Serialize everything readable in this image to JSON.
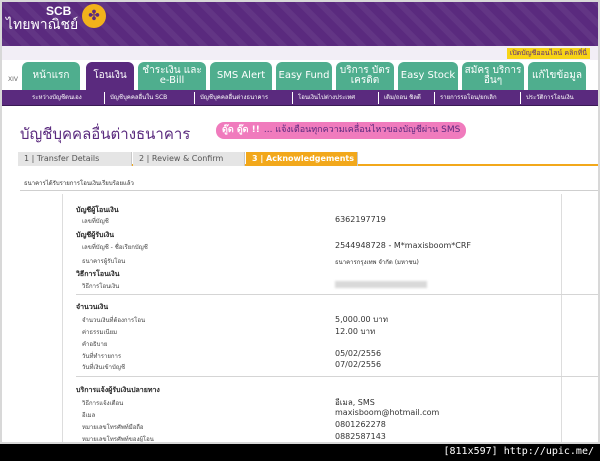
{
  "header": {
    "logo_text": "SCB",
    "logo_thai": "ไทยพาณิชย์",
    "logo_icon": "scb-emblem-icon",
    "badge": "เปิดบัญชีออนไลน์ คลิกที่นี่",
    "side_label": "XIV"
  },
  "tabs": [
    {
      "label": "หน้าแรก"
    },
    {
      "label": "โอนเงิน"
    },
    {
      "label": "ชำระเงิน และ e-Bill"
    },
    {
      "label": "SMS Alert"
    },
    {
      "label": "Easy Fund"
    },
    {
      "label": "บริการ บัตรเครดิต"
    },
    {
      "label": "Easy Stock"
    },
    {
      "label": "สมัคร บริการอื่นๆ"
    },
    {
      "label": "แก้ไขข้อมูล"
    }
  ],
  "subnav": [
    {
      "label": "ระหว่างบัญชีตนเอง"
    },
    {
      "label": "บัญชีบุคคลอื่นใน SCB"
    },
    {
      "label": "บัญชีบุคคลอื่นต่างธนาคาร"
    },
    {
      "label": "โอนเงินไปต่างประเทศ"
    },
    {
      "label": "เติม/ถอน ชิลดี"
    },
    {
      "label": "รายการรอโอน/ยกเลิก"
    },
    {
      "label": "ประวัติการโอนเงิน"
    }
  ],
  "page": {
    "title": "บัญชีบุคคลอื่นต่างธนาคาร",
    "promo_deal": "ดู๊ด ดู๊ด !!",
    "promo_text": "... แจ้งเตือนทุกความเคลื่อนไหวของบัญชีผ่าน SMS",
    "confirm": "ธนาคารได้รับรายการโอนเงินเรียบร้อยแล้ว"
  },
  "steps": [
    {
      "label": "1 | Transfer Details"
    },
    {
      "label": "2 | Review & Confirm"
    },
    {
      "label": "3 | Acknowledgements"
    }
  ],
  "details": {
    "from_head": "บัญชีผู้โอนเงิน",
    "from_account_label": "เลขที่บัญชี",
    "from_account": "6362197719",
    "to_head": "บัญชีผู้รับเงิน",
    "to_account_label": "เลขที่บัญชี - ชื่อเรียกบัญชี",
    "to_account": "2544948728 - M*maxisboom*CRF",
    "to_bank_label": "ธนาคารผู้รับโอน",
    "to_bank": "ธนาคารกรุงเทพ จำกัด (มหาชน)",
    "method_head": "วิธีการโอนเงิน",
    "method_label": "วิธีการโอนเงิน",
    "amount_head": "จำนวนเงิน",
    "amount_label": "จำนวนเงินที่ต้องการโอน",
    "amount": "5,000.00 บาท",
    "fee_label": "ค่าธรรมเนียม",
    "fee": "12.00 บาท",
    "desc_label": "คำอธิบาย",
    "date_label": "วันที่ทำรายการ",
    "date": "05/02/2556",
    "effective_label": "วันที่เงินเข้าบัญชี",
    "effective": "07/02/2556",
    "notify_head": "บริการแจ้งผู้รับเงินปลายทาง",
    "notify_method_label": "วิธีการแจ้งเตือน",
    "notify_method": "อีเมล, SMS",
    "email_label": "อีเมล",
    "email": "maxisboom@hotmail.com",
    "mobile_label": "หมายเลขโทรศัพท์มือถือ",
    "mobile": "0801262278",
    "sender_mobile_label": "หมายเลขโทรศัพท์ของผู้โอน",
    "sender_mobile": "0882587143"
  },
  "footer": "[811x597] http://upic.me/",
  "colors": {
    "brand": "#5a2a7e",
    "tab_green": "#4fae8e",
    "step_active": "#f2a81b",
    "promo": "#f07bbd",
    "badge": "#f7d417"
  }
}
